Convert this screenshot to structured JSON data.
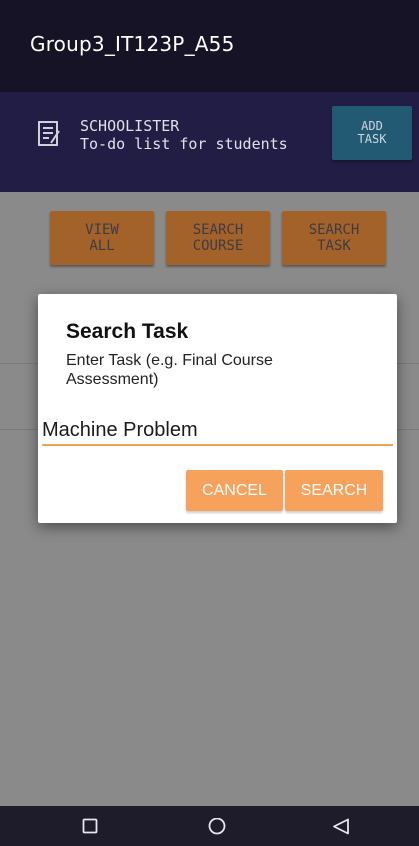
{
  "app_bar": {
    "title": "Group3_IT123P_A55"
  },
  "header": {
    "title": "SCHOOLISTER",
    "subtitle": "To-do list for students",
    "icon": "notepad-icon",
    "add_button_line1": "ADD",
    "add_button_line2": "TASK"
  },
  "nav_buttons": [
    {
      "line1": "VIEW",
      "line2": "ALL"
    },
    {
      "line1": "SEARCH",
      "line2": "COURSE"
    },
    {
      "line1": "SEARCH",
      "line2": "TASK"
    }
  ],
  "dialog": {
    "title": "Search Task",
    "message": "Enter Task (e.g. Final Course Assessment)",
    "input_value": "Machine Problem",
    "cancel_label": "CANCEL",
    "search_label": "SEARCH"
  },
  "system_nav": {
    "icons": [
      "recents-square-icon",
      "home-circle-icon",
      "back-triangle-icon"
    ]
  },
  "colors": {
    "app_bar": "#161326",
    "header": "#221d45",
    "add_button": "#235a73",
    "nav_button": "#a4622b",
    "dialog_accent": "#f7a25c"
  }
}
